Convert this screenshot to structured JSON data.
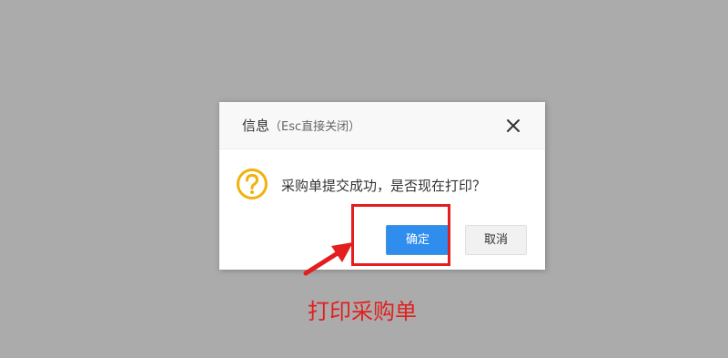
{
  "dialog": {
    "title": "信息",
    "title_hint": "（Esc直接关闭）",
    "close_icon": "close-icon",
    "question_icon": "question-icon",
    "icon_color": "#f0b20e",
    "message": "采购单提交成功，是否现在打印？",
    "confirm_label": "确定",
    "cancel_label": "取消",
    "confirm_color": "#2e8ded"
  },
  "annotation": {
    "caption": "打印采购单",
    "color": "#e41e1e",
    "arrow_icon": "arrow-icon"
  }
}
